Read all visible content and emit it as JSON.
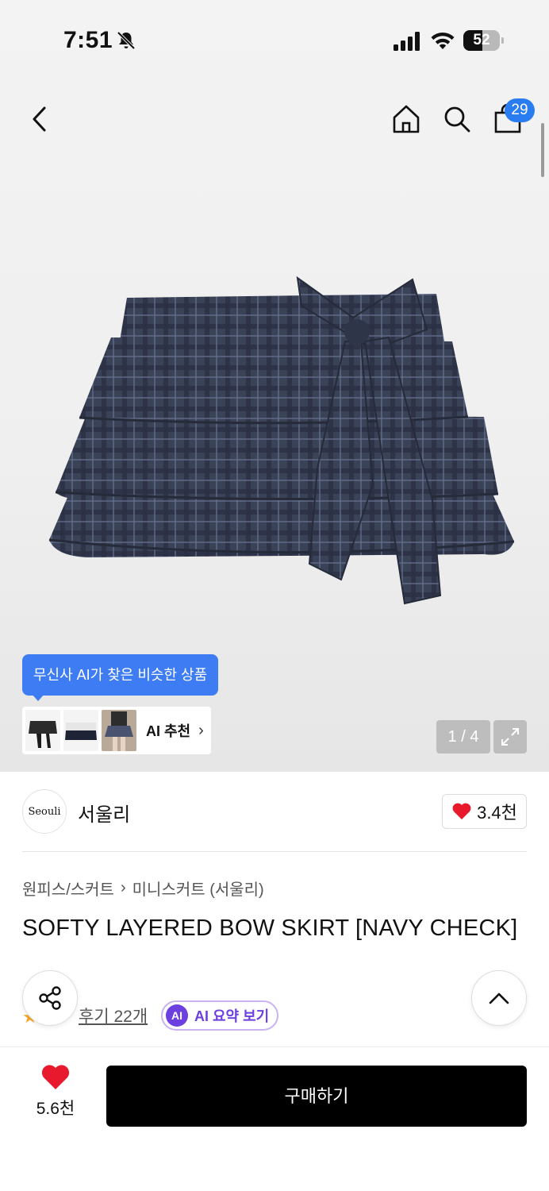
{
  "status_bar": {
    "time": "7:51",
    "battery": "52",
    "battery_level": 0.52
  },
  "nav": {
    "cart_count": "29"
  },
  "gallery": {
    "ai_tooltip": "무신사 AI가 찾은 비슷한 상품",
    "ai_rec_label": "AI 추천",
    "pager": "1 / 4"
  },
  "brand": {
    "logo_text": "Seouli",
    "name": "서울리",
    "likes": "3.4천"
  },
  "product": {
    "category": "원피스/스커트",
    "subcategory": "미니스커트 (서울리)",
    "title": "SOFTY LAYERED BOW SKIRT [NAVY CHECK]",
    "review_link": "후기 22개",
    "ai_summary_icon": "AI",
    "ai_summary_label": "AI 요약 보기"
  },
  "bottom": {
    "like_count": "5.6천",
    "buy_label": "구매하기"
  },
  "colors": {
    "accent_blue": "#3d7cf2",
    "badge_blue": "#2a7df0",
    "heart_red": "#e8192c",
    "ai_purple": "#6b3fe0",
    "skirt_navy": "#3a4258"
  },
  "icons": {
    "back": "chevron-left-icon",
    "home": "home-icon",
    "search": "search-icon",
    "cart": "shopping-bag-icon",
    "share": "share-icon",
    "top": "chevron-up-icon",
    "heart": "heart-icon",
    "expand": "expand-icon"
  }
}
